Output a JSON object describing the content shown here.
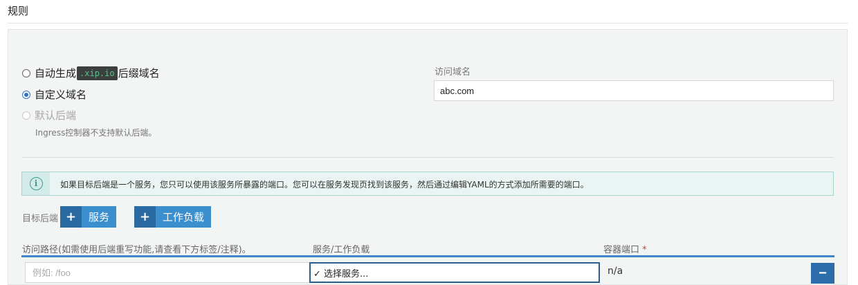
{
  "section": {
    "title": "规则"
  },
  "host_options": [
    {
      "prefix": "自动生成",
      "code": ".xip.io",
      "suffix": "后缀域名",
      "checked": false,
      "disabled": false
    },
    {
      "prefix": "自定义域名",
      "checked": true,
      "disabled": false
    },
    {
      "prefix": "默认后端",
      "checked": false,
      "disabled": true
    }
  ],
  "default_backend_help": "Ingress控制器不支持默认后端。",
  "domain": {
    "label": "访问域名",
    "value": "abc.com"
  },
  "info": {
    "icon": "info-circle-icon",
    "text": "如果目标后端是一个服务，您只可以使用该服务所暴露的端口。您可以在服务发现页找到该服务，然后通过编辑YAML的方式添加所需要的端口。"
  },
  "target": {
    "label": "目标后端",
    "add_service_label": "服务",
    "add_workload_label": "工作负载",
    "plus_symbol": "+"
  },
  "table": {
    "col_path": "访问路径(如需使用后端重写功能,请查看下方标签/注释)。",
    "col_service": "服务/工作负载",
    "col_port": "容器端口",
    "required_marker": "*",
    "row": {
      "path_placeholder": "例如: /foo",
      "service_selected": "✓ 选择服务...",
      "port": "n/a",
      "remove_symbol": "−"
    }
  },
  "colors": {
    "accent": "#3c8fcf",
    "accent_dark": "#2a6aa2",
    "info_border": "#a8d4cf",
    "code_green": "#5fc08d"
  }
}
